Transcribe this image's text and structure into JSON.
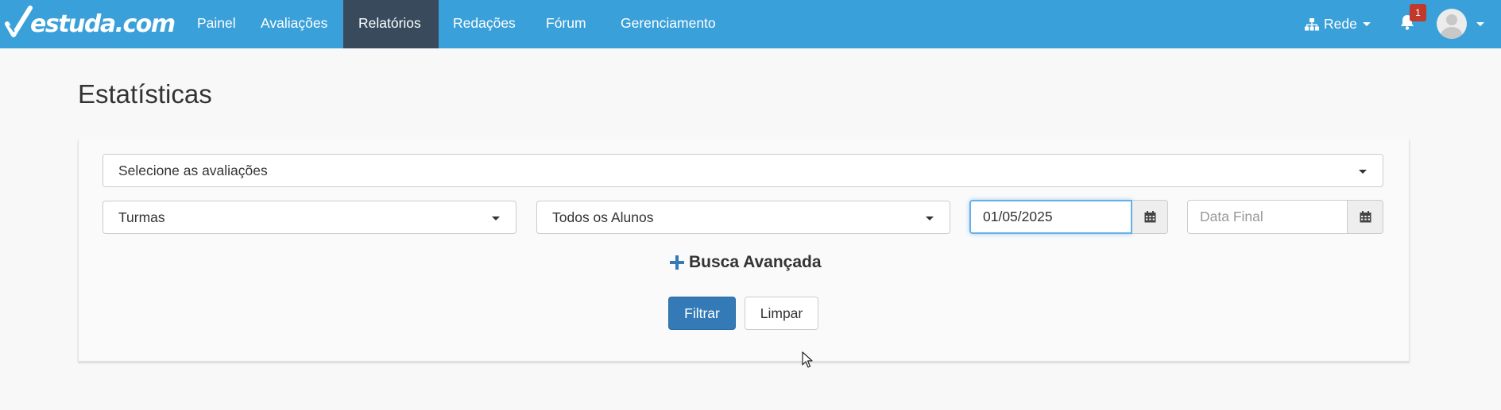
{
  "navbar": {
    "brand": "estuda.com",
    "items": [
      {
        "label": "Painel",
        "active": false
      },
      {
        "label": "Avaliações",
        "active": false
      },
      {
        "label": "Relatórios",
        "active": true
      },
      {
        "label": "Redações",
        "active": false
      },
      {
        "label": "Fórum",
        "active": false
      },
      {
        "label": "Gerenciamento",
        "active": false
      }
    ],
    "rede_label": "Rede",
    "notification_count": "1"
  },
  "page": {
    "title": "Estatísticas"
  },
  "filters": {
    "avaliacoes_select": "Selecione as avaliações",
    "turmas_select": "Turmas",
    "alunos_select": "Todos os Alunos",
    "data_inicial_value": "01/05/2025",
    "data_final_placeholder": "Data Final",
    "busca_avancada": "Busca Avançada",
    "filtrar_button": "Filtrar",
    "limpar_button": "Limpar"
  },
  "colors": {
    "navbar": "#3aa0d9",
    "active_nav": "#384a5c",
    "primary": "#337ab7",
    "badge": "#c0392b"
  },
  "icons": {
    "brand": "checkmark-logo-icon",
    "rede": "sitemap-icon",
    "notifications": "bell-icon",
    "calendar": "calendar-icon",
    "advanced": "plus-icon"
  }
}
